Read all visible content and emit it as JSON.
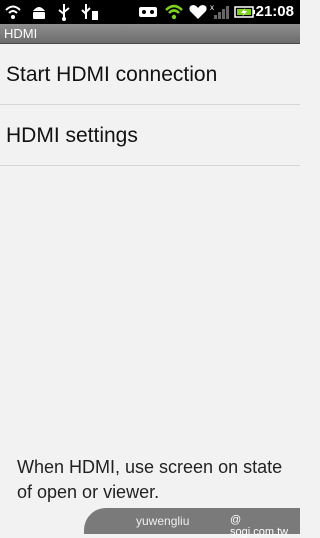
{
  "status_bar": {
    "time": "21:08",
    "icons": [
      "wifi-icon",
      "android-debug-icon",
      "usb-icon",
      "usb-storage-icon",
      "voicemail-icon",
      "wifi-signal-icon",
      "heart-app-icon",
      "no-signal-icon",
      "battery-charging-icon"
    ]
  },
  "title_bar": {
    "title": "HDMI"
  },
  "list": {
    "items": [
      {
        "label": "Start HDMI connection"
      },
      {
        "label": "HDMI settings"
      }
    ]
  },
  "footer": {
    "text": "When HDMI, use screen on state of open or viewer."
  },
  "watermark": {
    "user": "yuwengliu",
    "site": "@ sogi.com.tw"
  },
  "colors": {
    "status_bar": "#000000",
    "title_bar": "#7d7d7d",
    "background": "#f2f2f2",
    "battery": "#7ed321"
  }
}
